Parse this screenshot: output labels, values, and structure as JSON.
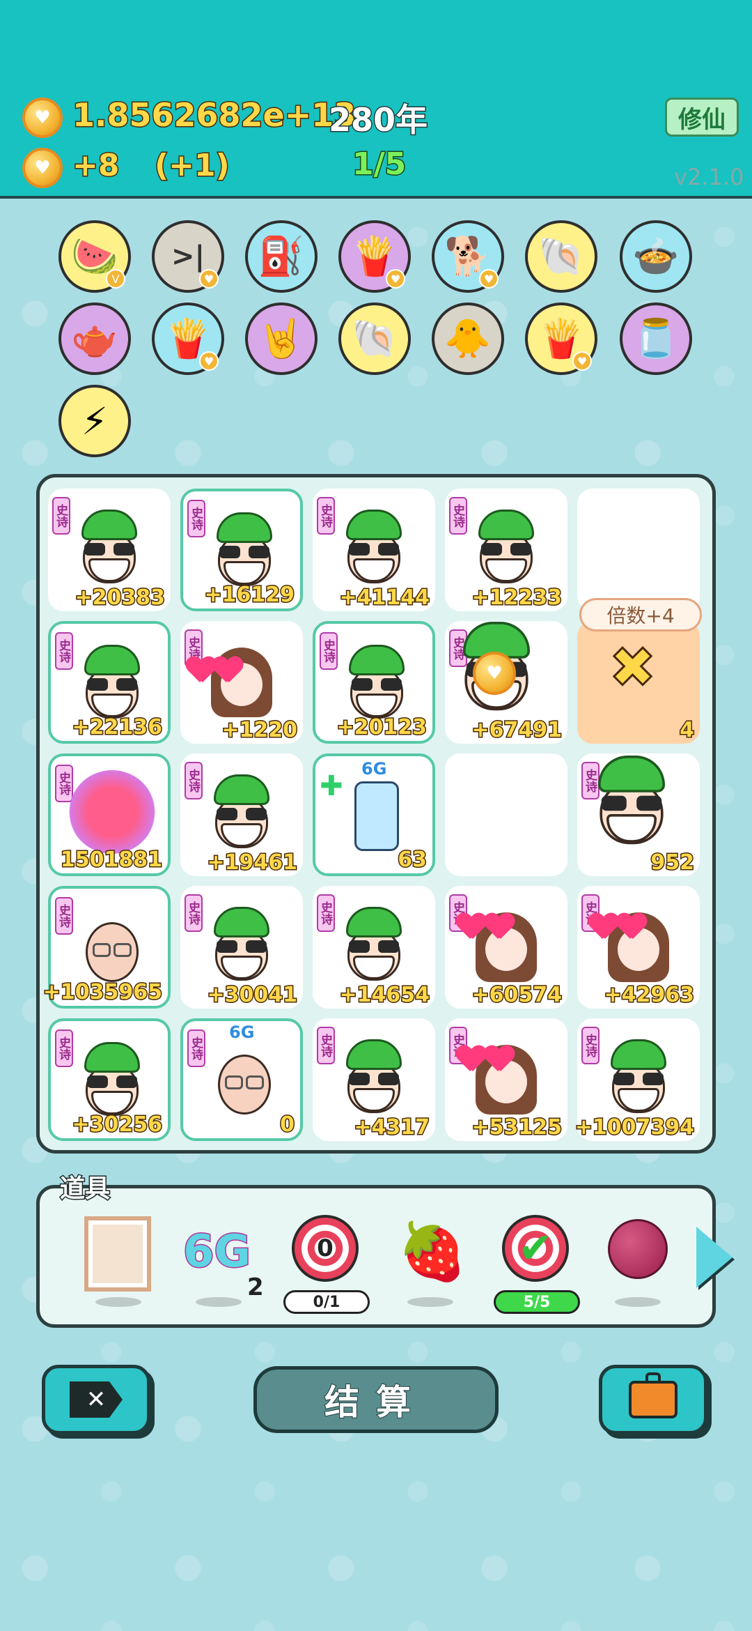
{
  "header": {
    "coins_total": "1.8562682e+13",
    "year": "280年",
    "income": "+8",
    "income_bonus": "(+1)",
    "progress": "1/5",
    "xiuxian_label": "修仙",
    "version": "v2.1.0"
  },
  "inventory": {
    "symbols": [
      {
        "name": "fruit-bowl",
        "glyph": "🍉",
        "bg": "#fff18a"
      },
      {
        "name": "skip",
        "glyph": ">|",
        "bg": "#d9d4c8"
      },
      {
        "name": "pump",
        "glyph": "⛽",
        "bg": "#9fe6f2"
      },
      {
        "name": "fries",
        "glyph": "🍟",
        "bg": "#d9a8e8"
      },
      {
        "name": "dog",
        "glyph": "🐕",
        "bg": "#9fe6f2"
      },
      {
        "name": "shell",
        "glyph": "🐚",
        "bg": "#fff18a"
      },
      {
        "name": "pot",
        "glyph": "🍲",
        "bg": "#9fe6f2"
      },
      {
        "name": "gravy-boat",
        "glyph": "🫖",
        "bg": "#d9a8e8"
      },
      {
        "name": "fries",
        "glyph": "🍟",
        "bg": "#9fe6f2"
      },
      {
        "name": "rock-hand",
        "glyph": "🤘",
        "bg": "#d9a8e8"
      },
      {
        "name": "shell",
        "glyph": "🐚",
        "bg": "#fff18a"
      },
      {
        "name": "chick",
        "glyph": "🐥",
        "bg": "#d9d4c8"
      },
      {
        "name": "fries",
        "glyph": "🍟",
        "bg": "#fff18a"
      },
      {
        "name": "jar",
        "glyph": "🫙",
        "bg": "#d9a8e8"
      },
      {
        "name": "lightning",
        "glyph": "⚡",
        "bg": "#fff18a"
      }
    ]
  },
  "board": {
    "tag_label": "史诗",
    "multiplier_label": "倍数+4",
    "cells": [
      {
        "type": "green",
        "value": "+20383",
        "teal": false
      },
      {
        "type": "green",
        "value": "+16129",
        "teal": true
      },
      {
        "type": "green",
        "value": "+41144",
        "teal": false
      },
      {
        "type": "green",
        "value": "+12233",
        "teal": false
      },
      {
        "type": "empty",
        "value": "",
        "teal": false
      },
      {
        "type": "green",
        "value": "+22136",
        "teal": true
      },
      {
        "type": "girl",
        "value": "+1220",
        "teal": false
      },
      {
        "type": "green",
        "value": "+20123",
        "teal": true
      },
      {
        "type": "green",
        "value": "+67491",
        "teal": false
      },
      {
        "type": "special",
        "value": "4",
        "teal": false
      },
      {
        "type": "heart",
        "value": "1501881",
        "teal": true
      },
      {
        "type": "green",
        "value": "+19461",
        "teal": false
      },
      {
        "type": "fridge",
        "value": "63",
        "teal": true
      },
      {
        "type": "empty",
        "value": "",
        "teal": false
      },
      {
        "type": "green",
        "value": "952",
        "teal": false
      },
      {
        "type": "bald",
        "value": "+1035965",
        "teal": true
      },
      {
        "type": "green",
        "value": "+30041",
        "teal": false
      },
      {
        "type": "green",
        "value": "+14654",
        "teal": false
      },
      {
        "type": "girl",
        "value": "+60574",
        "teal": false
      },
      {
        "type": "girl",
        "value": "+42963",
        "teal": false
      },
      {
        "type": "green",
        "value": "+30256",
        "teal": true
      },
      {
        "type": "bald",
        "value": "0",
        "teal": true
      },
      {
        "type": "green",
        "value": "+4317",
        "teal": false
      },
      {
        "type": "girl",
        "value": "+53125",
        "teal": false
      },
      {
        "type": "green",
        "value": "+1007394",
        "teal": false
      }
    ]
  },
  "items": {
    "title": "道具",
    "frame_label": "",
    "sixg_label": "6G",
    "sixg_count": "2",
    "target1_value": "0",
    "target1_progress": "0/1",
    "target2_progress": "5/5"
  },
  "buttons": {
    "settle_label": "结算"
  },
  "colors": {
    "header_bg": "#17c2c0",
    "page_bg": "#a9dde4",
    "gold_text": "#ffd84a",
    "green_progress": "#7cf05b"
  }
}
